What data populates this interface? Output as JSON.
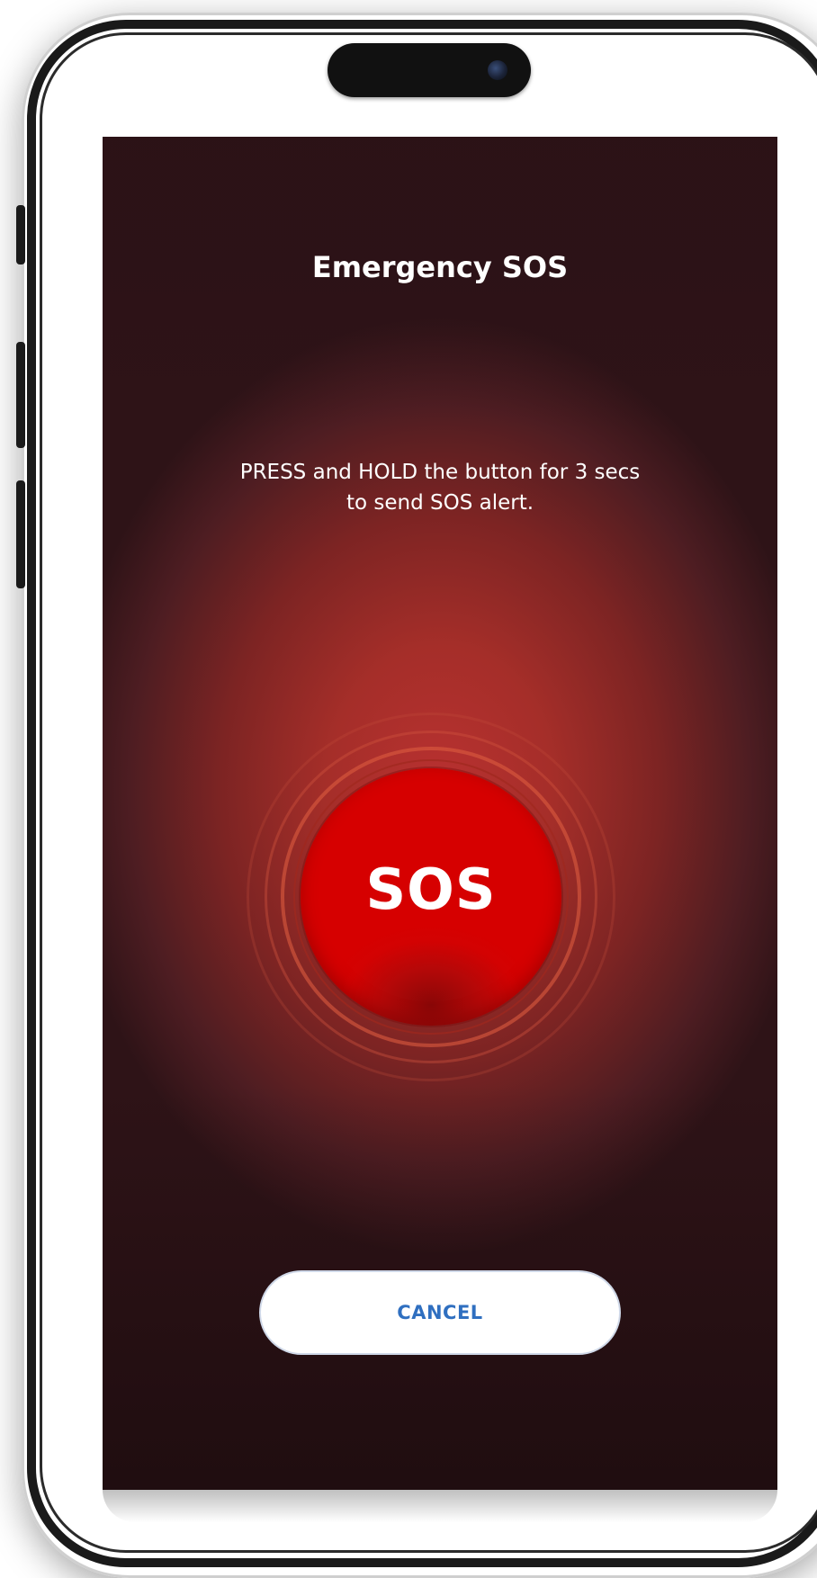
{
  "screen": {
    "title": "Emergency SOS",
    "instruction_line_1": "PRESS and HOLD the button for 3 secs",
    "instruction_line_2": "to send SOS alert.",
    "sos_button_label": "SOS",
    "cancel_button_label": "CANCEL"
  },
  "colors": {
    "background_center": "#b83130",
    "background_edge": "#2e1317",
    "sos_button": "#d30202",
    "cancel_button_bg": "#ffffff",
    "cancel_button_text": "#2f6fc0",
    "text_primary": "#ffffff"
  },
  "device": {
    "frame_icon": "phone-frame-icon",
    "camera_icon": "camera-icon"
  }
}
